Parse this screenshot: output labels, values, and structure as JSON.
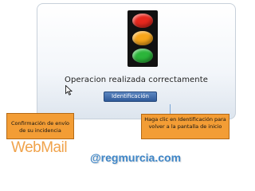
{
  "app": {
    "status_icon": "traffic-light-icon"
  },
  "result": {
    "message": "Operacion realizada correctamente",
    "button_label": "Identificación"
  },
  "lights": {
    "red": "#e8281e",
    "amber": "#f7a51a",
    "green": "#2bb53a"
  },
  "callouts": {
    "left": "Confirmación de envío de su incidencia",
    "right": "Haga clic en Identificación para volver a la pantalla de inicio"
  },
  "branding": {
    "webmail": "WebMail",
    "site": "@regmurcia.com"
  },
  "colors": {
    "callout": "#f39d35",
    "button": "#2f5a98",
    "brand_orange": "#f0a34c",
    "brand_blue": "#3e86c8"
  }
}
